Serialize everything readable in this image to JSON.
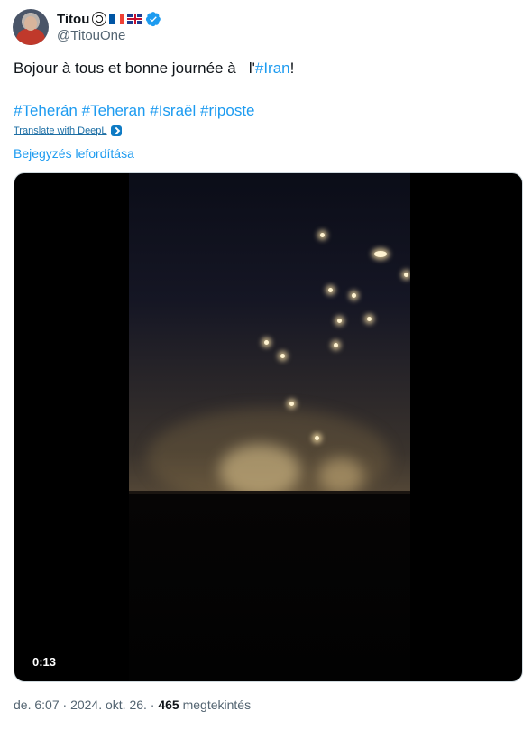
{
  "author": {
    "display_name": "Titou",
    "handle": "@TitouOne",
    "emoji_icons": [
      "soccer-ball-icon",
      "flag-france-icon",
      "flag-uk-icon"
    ],
    "verified_color": "#1d9bf0"
  },
  "tweet": {
    "text_prefix": "Bojour à tous et bonne journée à   l'",
    "text_hashtag": "#Iran",
    "text_suffix": "!",
    "hashtags": [
      "#Teherán",
      "#Teheran",
      "#Israël",
      "#riposte"
    ],
    "translate_deepl": "Translate with DeepL",
    "translate_post": "Bejegyzés lefordítása"
  },
  "media": {
    "duration": "0:13"
  },
  "meta": {
    "time": "de. 6:07",
    "date": "2024. okt. 26.",
    "separator": "·",
    "views_count": "465",
    "views_label": "megtekintés"
  },
  "colors": {
    "link": "#1d9bf0",
    "secondary_text": "#536471",
    "primary_text": "#0f1419"
  }
}
